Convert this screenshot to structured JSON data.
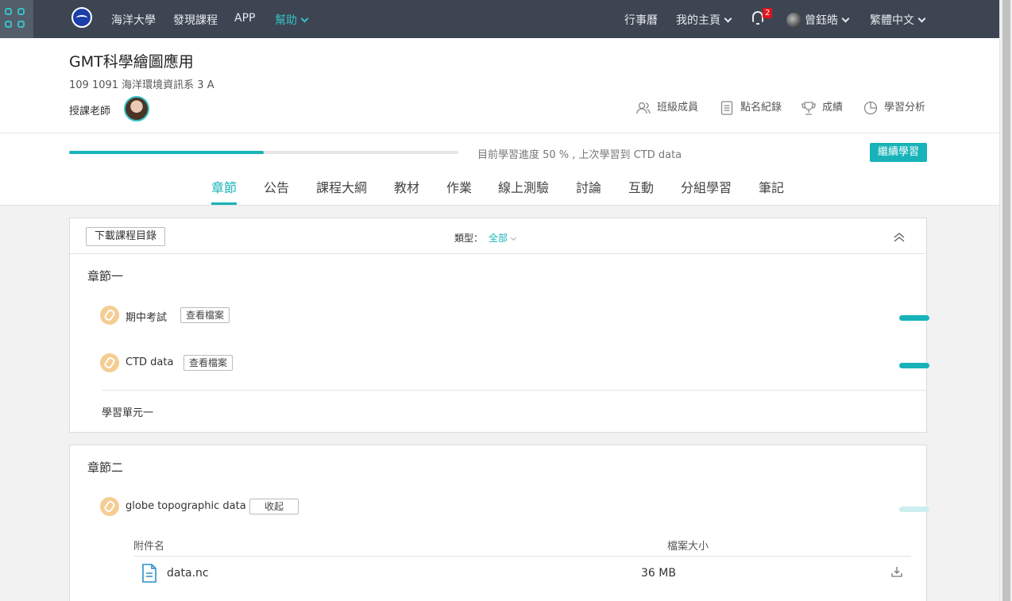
{
  "nav": {
    "links": [
      "海洋大學",
      "發現課程",
      "APP"
    ],
    "help": "幫助",
    "calendar": "行事曆",
    "home": "我的主頁",
    "notifications": "2",
    "user": "曾鈺皓",
    "language": "繁體中文"
  },
  "course": {
    "title": "GMT科學繪圖應用",
    "subtitle": "109 1091 海洋環境資訊系 3 A",
    "teacher_label": "授課老師"
  },
  "quick_links": [
    "班級成員",
    "點名紀錄",
    "成績",
    "學習分析"
  ],
  "progress": {
    "percent": 50,
    "text": "目前學習進度 50 % , 上次學習到 CTD data",
    "continue": "繼續學習"
  },
  "tabs": [
    "章節",
    "公告",
    "課程大綱",
    "教材",
    "作業",
    "線上測驗",
    "討論",
    "互動",
    "分組學習",
    "筆記"
  ],
  "toolbar": {
    "download": "下載課程目錄",
    "type_label": "類型：",
    "type_value": "全部"
  },
  "chapter1": {
    "title": "章節一",
    "items": [
      {
        "name": "期中考試",
        "action": "查看檔案",
        "progress": 1.0
      },
      {
        "name": "CTD data",
        "action": "查看檔案",
        "progress": 1.0
      }
    ],
    "unit": "學習單元一"
  },
  "chapter2": {
    "title": "章節二",
    "item": {
      "name": "globe topographic data",
      "action": "收起",
      "progress": 0
    },
    "attachment_headers": {
      "name": "附件名",
      "size": "檔案大小"
    },
    "files": [
      {
        "name": "data.nc",
        "size": "36 MB"
      }
    ]
  },
  "colors": {
    "accent": "#17b3b8",
    "nav_bg": "#3d4552",
    "badge": "#e1131d",
    "clip": "#f5cd92"
  }
}
